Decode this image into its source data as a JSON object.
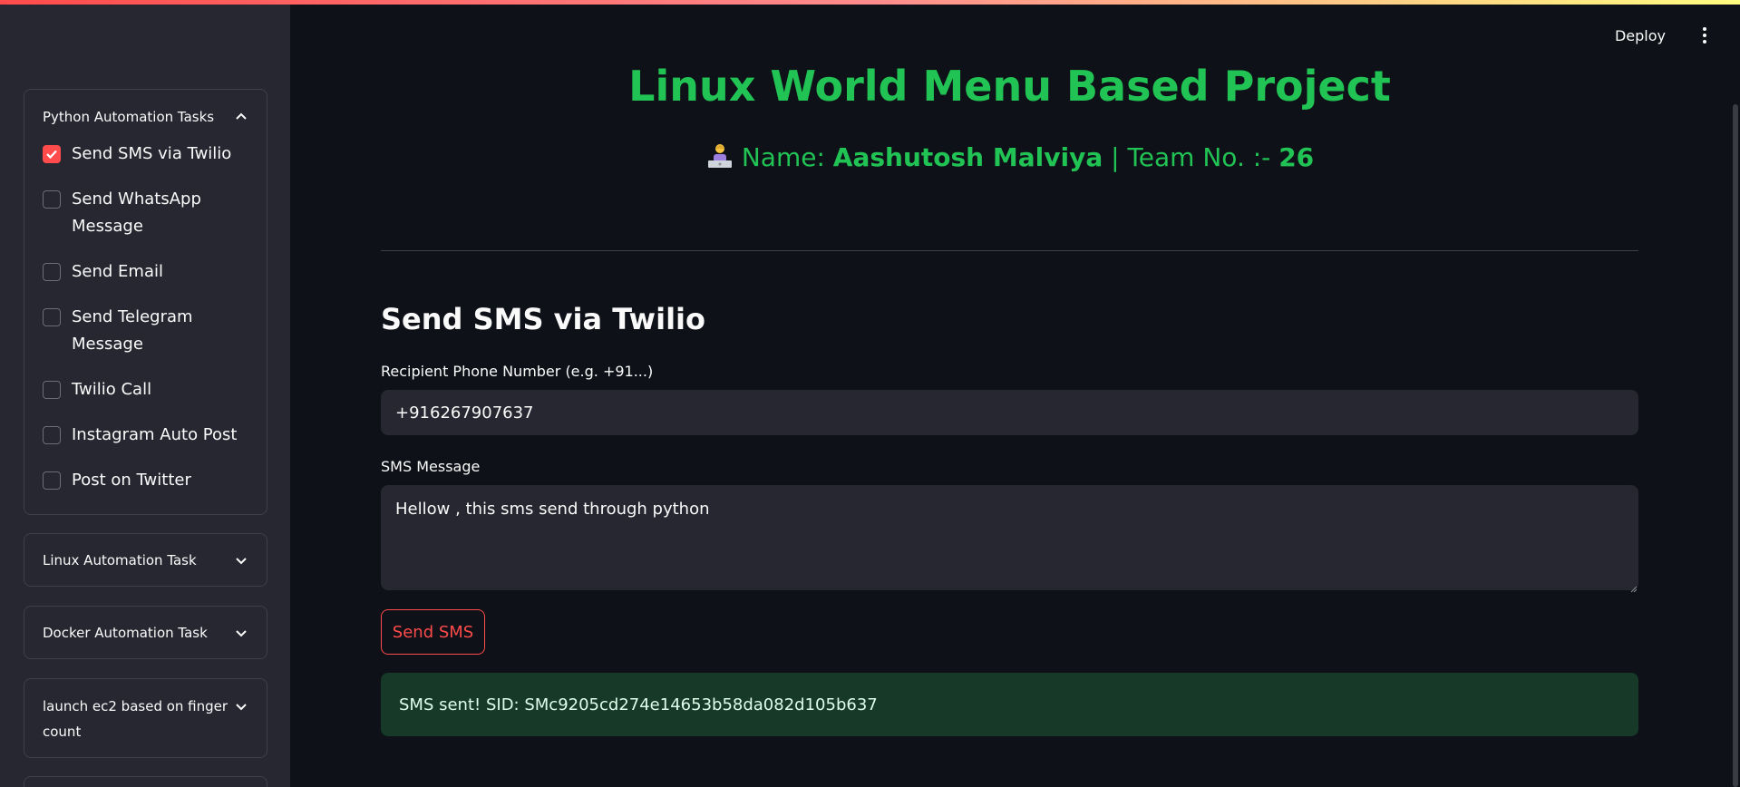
{
  "app": {
    "accent": "#ff4b4b",
    "title_color": "#21c354"
  },
  "header": {
    "deploy_label": "Deploy",
    "menu_icon": "kebab-menu-icon"
  },
  "sidebar": {
    "expanders": [
      {
        "label": "Python Automation Tasks",
        "expanded": true,
        "items": [
          {
            "label": "Send SMS via Twilio",
            "checked": true
          },
          {
            "label": "Send WhatsApp Message",
            "checked": false
          },
          {
            "label": "Send Email",
            "checked": false
          },
          {
            "label": "Send Telegram Message",
            "checked": false
          },
          {
            "label": "Twilio Call",
            "checked": false
          },
          {
            "label": "Instagram Auto Post",
            "checked": false
          },
          {
            "label": "Post on Twitter",
            "checked": false
          }
        ]
      },
      {
        "label": "Linux Automation Task",
        "expanded": false
      },
      {
        "label": "Docker Automation Task",
        "expanded": false
      },
      {
        "label": "launch ec2 based on finger count",
        "expanded": false
      }
    ]
  },
  "main": {
    "title": "Linux World Menu Based Project",
    "subtitle": {
      "name_prefix": "Name: ",
      "name": "Aashutosh Malviya",
      "team_label": " | Team No. :- ",
      "team_no": "26"
    },
    "section_title": "Send SMS via Twilio",
    "phone": {
      "label": "Recipient Phone Number (e.g. +91...)",
      "value": "+916267907637"
    },
    "message": {
      "label": "SMS Message",
      "value": "Hellow , this sms send through python"
    },
    "send_button": "Send SMS",
    "success_message": "SMS sent! SID: SMc9205cd274e14653b58da082d105b637"
  }
}
